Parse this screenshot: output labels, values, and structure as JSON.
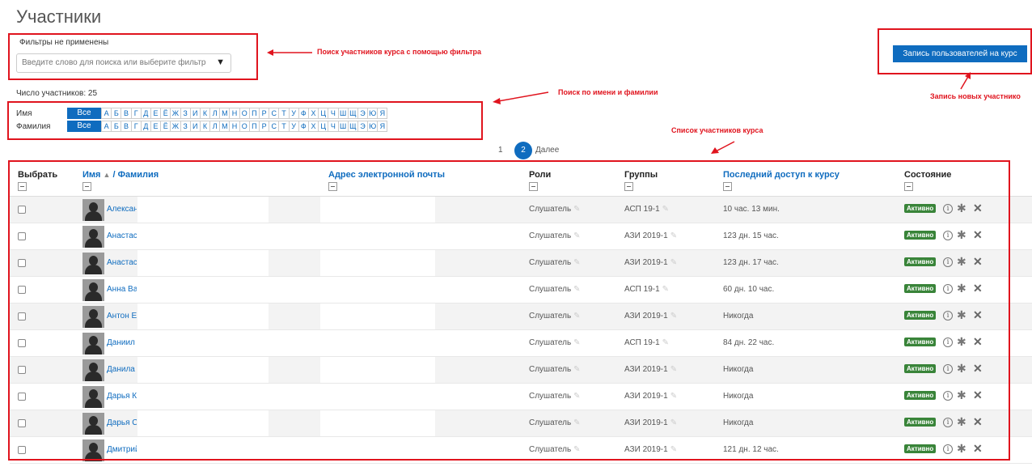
{
  "page": {
    "title": "Участники"
  },
  "filter": {
    "label": "Фильтры не применены",
    "placeholder": "Введите слово для поиска или выберите фильтр"
  },
  "enroll_button": {
    "label": "Запись пользователей на курс"
  },
  "participant_count": "Число участников: 25",
  "alphabet": {
    "first_name_label": "Имя",
    "last_name_label": "Фамилия",
    "all_label": "Все",
    "letters": [
      "А",
      "Б",
      "В",
      "Г",
      "Д",
      "Е",
      "Ё",
      "Ж",
      "З",
      "И",
      "К",
      "Л",
      "М",
      "Н",
      "О",
      "П",
      "Р",
      "С",
      "Т",
      "У",
      "Ф",
      "Х",
      "Ц",
      "Ч",
      "Ш",
      "Щ",
      "Э",
      "Ю",
      "Я"
    ]
  },
  "pagination": {
    "page1": "1",
    "page2": "2",
    "next": "Далее"
  },
  "annotations": {
    "filter": "Поиск участников курса с помощью фильтра",
    "name_search": "Поиск по имени и фамилии",
    "list": "Список участников курса",
    "enroll": "Запись новых участнико"
  },
  "table": {
    "headers": {
      "select": "Выбрать",
      "name": "Имя",
      "surname": "/ Фамилия",
      "email": "Адрес электронной почты",
      "roles": "Роли",
      "groups": "Группы",
      "last_access": "Последний доступ к курсу",
      "status": "Состояние"
    },
    "rows": [
      {
        "name": "Александр",
        "role": "Слушатель",
        "group": "АСП 19-1",
        "last_access": "10 час. 13 мин.",
        "status": "Активно"
      },
      {
        "name": "Анастасия",
        "role": "Слушатель",
        "group": "АЗИ 2019-1",
        "last_access": "123 дн. 15 час.",
        "status": "Активно"
      },
      {
        "name": "Анастасия",
        "role": "Слушатель",
        "group": "АЗИ 2019-1",
        "last_access": "123 дн. 17 час.",
        "status": "Активно"
      },
      {
        "name": "Анна Ва",
        "role": "Слушатель",
        "group": "АСП 19-1",
        "last_access": "60 дн. 10 час.",
        "status": "Активно"
      },
      {
        "name": "Антон Е",
        "role": "Слушатель",
        "group": "АЗИ 2019-1",
        "last_access": "Никогда",
        "status": "Активно"
      },
      {
        "name": "Даниил",
        "role": "Слушатель",
        "group": "АСП 19-1",
        "last_access": "84 дн. 22 час.",
        "status": "Активно"
      },
      {
        "name": "Данила",
        "role": "Слушатель",
        "group": "АЗИ 2019-1",
        "last_access": "Никогда",
        "status": "Активно"
      },
      {
        "name": "Дарья К",
        "role": "Слушатель",
        "group": "АЗИ 2019-1",
        "last_access": "Никогда",
        "status": "Активно"
      },
      {
        "name": "Дарья С",
        "role": "Слушатель",
        "group": "АЗИ 2019-1",
        "last_access": "Никогда",
        "status": "Активно"
      },
      {
        "name": "Дмитрий",
        "role": "Слушатель",
        "group": "АЗИ 2019-1",
        "last_access": "121 дн. 12 час.",
        "status": "Активно"
      }
    ]
  },
  "colors": {
    "accent": "#0f6cbf",
    "annotation": "#e0141e",
    "active_badge": "#398439"
  }
}
